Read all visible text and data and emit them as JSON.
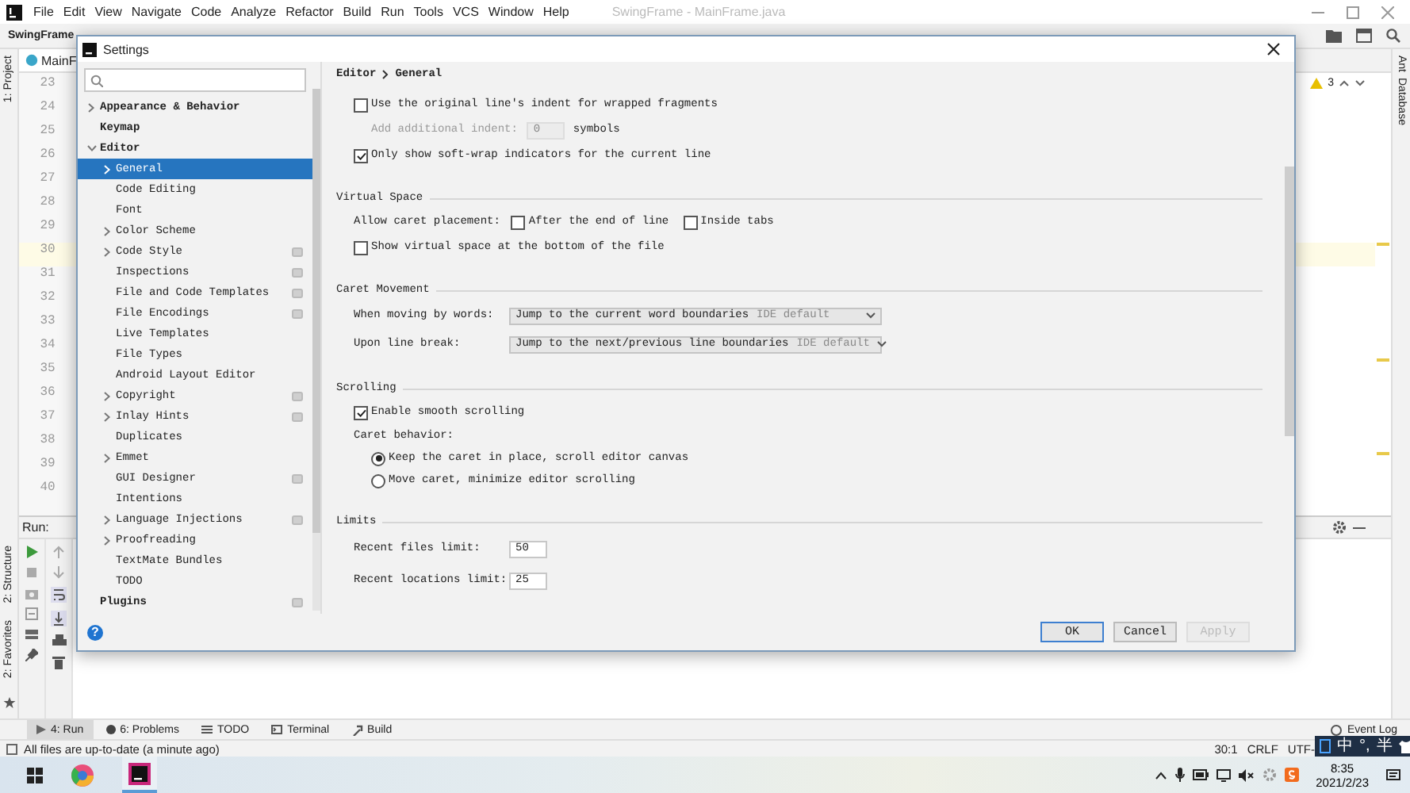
{
  "window": {
    "menu": [
      "File",
      "Edit",
      "View",
      "Navigate",
      "Code",
      "Analyze",
      "Refactor",
      "Build",
      "Run",
      "Tools",
      "VCS",
      "Window",
      "Help"
    ],
    "title": "SwingFrame - MainFrame.java"
  },
  "toolbar": {
    "project": "SwingFrame"
  },
  "editor": {
    "tab": "MainF",
    "warnings": "3",
    "lines": [
      {
        "number": "23",
        "current": false
      },
      {
        "number": "24",
        "current": false
      },
      {
        "number": "25",
        "current": false
      },
      {
        "number": "26",
        "current": false
      },
      {
        "number": "27",
        "current": false
      },
      {
        "number": "28",
        "current": false
      },
      {
        "number": "29",
        "current": false
      },
      {
        "number": "30",
        "current": true
      },
      {
        "number": "31",
        "current": false
      },
      {
        "number": "32",
        "current": false
      },
      {
        "number": "33",
        "current": false
      },
      {
        "number": "34",
        "current": false
      },
      {
        "number": "35",
        "current": false
      },
      {
        "number": "36",
        "current": false
      },
      {
        "number": "37",
        "current": false
      },
      {
        "number": "38",
        "current": false
      },
      {
        "number": "39",
        "current": false
      },
      {
        "number": "40",
        "current": false
      }
    ]
  },
  "side_tabs": {
    "left_top": "1: Project",
    "left_bottom": [
      "2: Structure",
      "2: Favorites"
    ],
    "right": [
      "Ant",
      "Database"
    ]
  },
  "run_panel": {
    "label": "Run:"
  },
  "tool_tabs": [
    {
      "label": "4: Run",
      "selected": true
    },
    {
      "label": "6: Problems",
      "selected": false
    },
    {
      "label": "TODO",
      "selected": false
    },
    {
      "label": "Terminal",
      "selected": false
    },
    {
      "label": "Build",
      "selected": false
    }
  ],
  "event_log": "Event Log",
  "status_bar": {
    "message": "All files are up-to-date (a minute ago)",
    "position": "30:1",
    "line_separator": "CRLF",
    "encoding": "UTF-"
  },
  "ime": [
    "中",
    "°,",
    "半"
  ],
  "taskbar": {
    "time": "8:35",
    "date": "2021/2/23"
  },
  "dialog": {
    "title": "Settings",
    "breadcrumb": [
      "Editor",
      "General"
    ],
    "help": "?",
    "tree": [
      {
        "label": "Appearance & Behavior",
        "selected": false,
        "expanded": false,
        "scoped": false
      },
      {
        "label": "Keymap",
        "selected": false,
        "scoped": false
      },
      {
        "label": "Editor",
        "selected": false,
        "expanded": true,
        "scoped": false,
        "children": [
          {
            "label": "General",
            "selected": true,
            "expanded": false,
            "scoped": false
          },
          {
            "label": "Code Editing",
            "selected": false,
            "scoped": false
          },
          {
            "label": "Font",
            "selected": false,
            "scoped": false
          },
          {
            "label": "Color Scheme",
            "selected": false,
            "expanded": false,
            "scoped": false
          },
          {
            "label": "Code Style",
            "selected": false,
            "expanded": false,
            "scoped": true
          },
          {
            "label": "Inspections",
            "selected": false,
            "scoped": true
          },
          {
            "label": "File and Code Templates",
            "selected": false,
            "scoped": true
          },
          {
            "label": "File Encodings",
            "selected": false,
            "scoped": true
          },
          {
            "label": "Live Templates",
            "selected": false,
            "scoped": false
          },
          {
            "label": "File Types",
            "selected": false,
            "scoped": false
          },
          {
            "label": "Android Layout Editor",
            "selected": false,
            "scoped": false
          },
          {
            "label": "Copyright",
            "selected": false,
            "expanded": false,
            "scoped": true
          },
          {
            "label": "Inlay Hints",
            "selected": false,
            "expanded": false,
            "scoped": true
          },
          {
            "label": "Duplicates",
            "selected": false,
            "scoped": false
          },
          {
            "label": "Emmet",
            "selected": false,
            "expanded": false,
            "scoped": false
          },
          {
            "label": "GUI Designer",
            "selected": false,
            "scoped": true
          },
          {
            "label": "Intentions",
            "selected": false,
            "scoped": false
          },
          {
            "label": "Language Injections",
            "selected": false,
            "expanded": false,
            "scoped": true
          },
          {
            "label": "Proofreading",
            "selected": false,
            "expanded": false,
            "scoped": false
          },
          {
            "label": "TextMate Bundles",
            "selected": false,
            "scoped": false
          },
          {
            "label": "TODO",
            "selected": false,
            "scoped": false
          }
        ]
      },
      {
        "label": "Plugins",
        "selected": false,
        "scoped": true
      }
    ],
    "sections": [
      {
        "rows": [
          {
            "kind": "checkbox",
            "label": "Use the original line's indent for wrapped fragments",
            "checked": false
          },
          {
            "kind": "subfield",
            "label": "Add additional indent:",
            "value": "0",
            "suffix": "symbols",
            "disabled": true
          },
          {
            "kind": "checkbox",
            "label": "Only show soft-wrap indicators for the current line",
            "checked": true
          }
        ]
      },
      {
        "title": "Virtual Space",
        "rows": [
          {
            "kind": "checkgroup",
            "label": "Allow caret placement:",
            "options": [
              {
                "label": "After the end of line",
                "checked": false
              },
              {
                "label": "Inside tabs",
                "checked": false
              }
            ]
          },
          {
            "kind": "checkbox",
            "label": "Show virtual space at the bottom of the file",
            "checked": false
          }
        ]
      },
      {
        "title": "Caret Movement",
        "rows": [
          {
            "kind": "combo",
            "label": "When moving by words:",
            "value": "Jump to the current word boundaries",
            "hint": "IDE default"
          },
          {
            "kind": "combo",
            "label": "Upon line break:",
            "value": "Jump to the next/previous line boundaries",
            "hint": "IDE default"
          }
        ]
      },
      {
        "title": "Scrolling",
        "rows": [
          {
            "kind": "checkbox",
            "label": "Enable smooth scrolling",
            "checked": true
          },
          {
            "kind": "label",
            "label": "Caret behavior:"
          },
          {
            "kind": "radio",
            "label": "Keep the caret in place, scroll editor canvas",
            "selected": true
          },
          {
            "kind": "radio",
            "label": "Move caret, minimize editor scrolling",
            "selected": false
          }
        ]
      },
      {
        "title": "Limits",
        "rows": [
          {
            "kind": "field",
            "label": "Recent files limit:",
            "value": "50",
            "disabled": false
          },
          {
            "kind": "field",
            "label": "Recent locations limit:",
            "value": "25",
            "disabled": false
          }
        ]
      }
    ],
    "buttons": [
      {
        "label": "OK",
        "default": true,
        "disabled": false
      },
      {
        "label": "Cancel",
        "default": false,
        "disabled": false
      },
      {
        "label": "Apply",
        "default": false,
        "disabled": true
      }
    ]
  }
}
